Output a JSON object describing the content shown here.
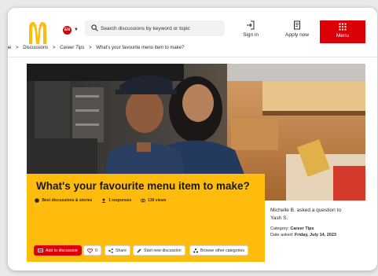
{
  "header": {
    "logo_icon": "golden-arches-icon",
    "language_badge": "EN",
    "search": {
      "placeholder": "Search discussions by keyword or topic",
      "value": ""
    },
    "sign_in": {
      "label": "Sign in",
      "icon": "sign-in-icon"
    },
    "apply_now": {
      "label": "Apply now",
      "icon": "application-icon"
    },
    "menu": {
      "label": "Menu",
      "icon": "grid-icon"
    },
    "colors": {
      "brand_red": "#db0007",
      "brand_yellow": "#ffbc0d"
    }
  },
  "breadcrumb": {
    "items": [
      "me",
      "Discussions",
      "Career Tips",
      "What's your favourite menu item to make?"
    ]
  },
  "post": {
    "title": "What's your favourite menu item to make?",
    "category_badge": "Best discussions & stories",
    "responses": "1 responses",
    "views": "130 views"
  },
  "actions": {
    "add": "Add to discussion",
    "likes": "0",
    "share": "Share",
    "new_discussion": "Start new discussion",
    "browse": "Browse other categories"
  },
  "side": {
    "asker_line1": "Michelle B. asked a question to",
    "asker_line2": "Yash S.",
    "category_label": "Category:",
    "category_value": "Career Tips",
    "date_label": "Date asked:",
    "date_value": "Friday, July 14, 2023"
  }
}
